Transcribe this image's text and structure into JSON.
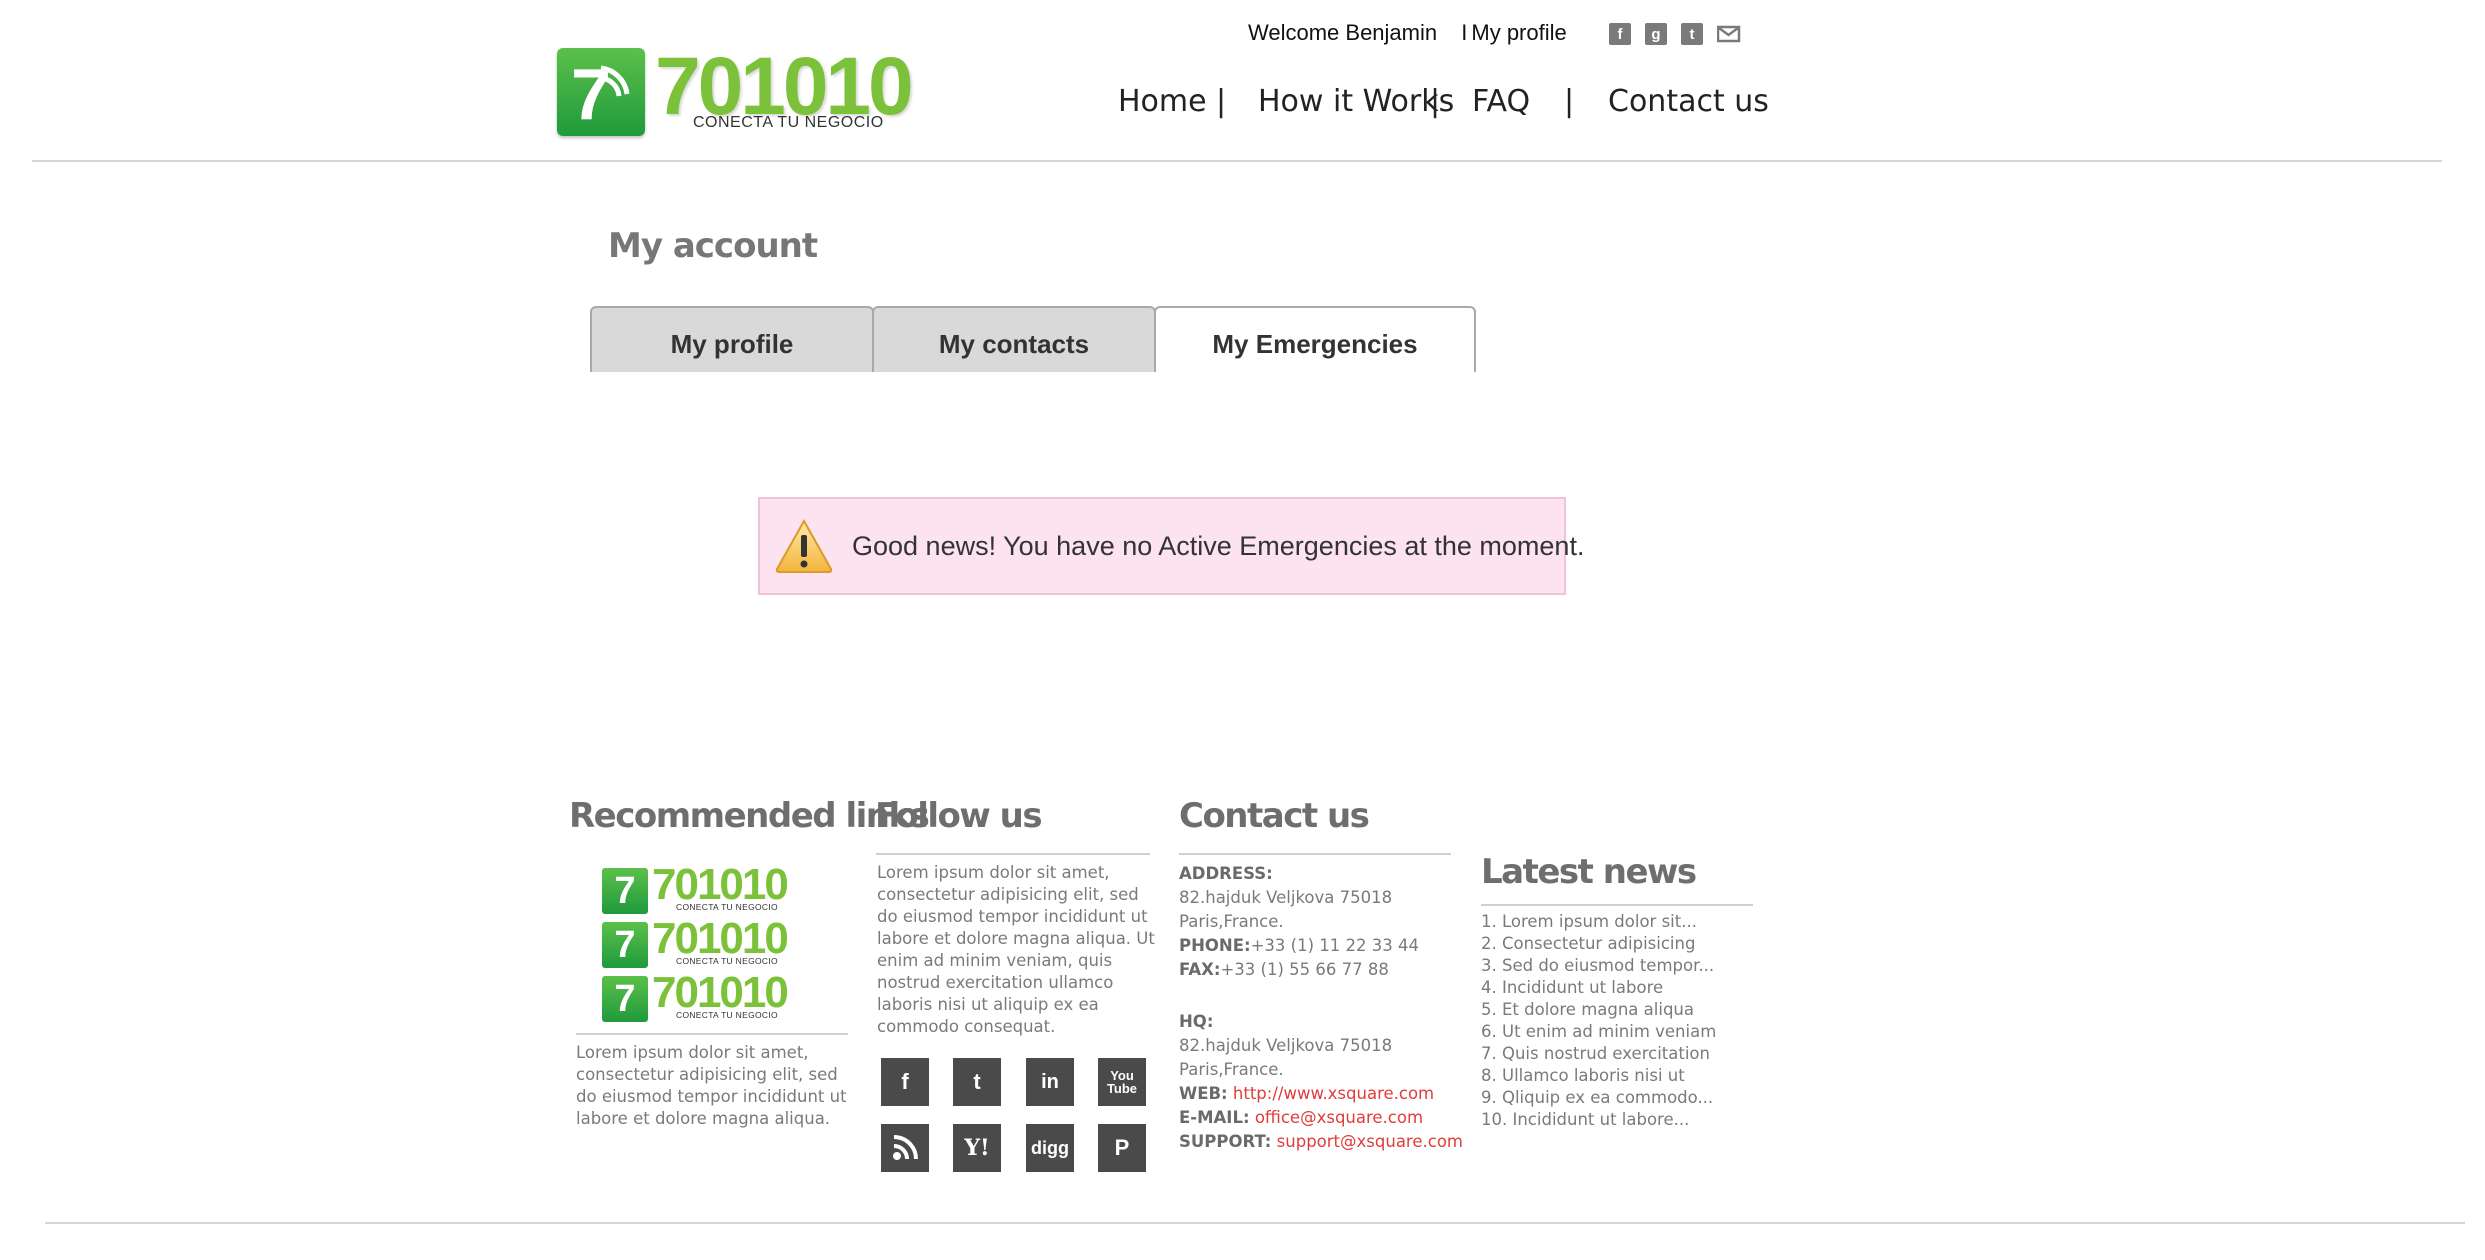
{
  "brand": {
    "logo_number": "701010",
    "logo_tagline": "CONECTA TU NEGOCIO",
    "logo_digit": "7",
    "primary_green": "#7cc13a",
    "dark_green": "#1f9a3c"
  },
  "topbar": {
    "welcome": "Welcome Benjamin",
    "separator": "I",
    "profile_link": "My profile",
    "social_icons": [
      "facebook-icon",
      "google-plus-icon",
      "twitter-icon",
      "mail-icon"
    ]
  },
  "nav": {
    "items": [
      "Home",
      "How it Works",
      "FAQ",
      "Contact us"
    ],
    "separator": "|"
  },
  "account": {
    "title": "My account",
    "tabs": [
      {
        "label": "My profile",
        "active": false
      },
      {
        "label": "My contacts",
        "active": false
      },
      {
        "label": "My Emergencies",
        "active": true
      }
    ]
  },
  "alert": {
    "icon": "warning-icon",
    "message": "Good news! You have no Active Emergencies at the moment.",
    "background": "#fde3ef"
  },
  "footer": {
    "recommended": {
      "title": "Recommended links",
      "text": "Lorem ipsum dolor sit amet, consectetur adipisicing elit, sed do eiusmod tempor incididunt ut labore et dolore magna aliqua."
    },
    "follow": {
      "title": "Follow us",
      "text": "Lorem ipsum dolor sit amet, consectetur adipisicing elit, sed do eiusmod tempor incididunt ut labore et dolore magna aliqua. Ut enim ad minim veniam, quis nostrud exercitation ullamco laboris nisi ut aliquip ex ea commodo consequat.",
      "icons": [
        "facebook-icon",
        "twitter-icon",
        "linkedin-icon",
        "youtube-icon",
        "rss-icon",
        "yahoo-icon",
        "digg-icon",
        "pinterest-icon"
      ],
      "icon_glyphs": [
        "f",
        "t",
        "in",
        "You Tube",
        "⋱",
        "Y!",
        "digg",
        "P"
      ]
    },
    "contact": {
      "title": "Contact us",
      "address_label": "ADDRESS:",
      "address_line1": "82.hajduk Veljkova 75018",
      "address_line2": "Paris,France.",
      "phone_label": "PHONE:",
      "phone": "+33 (1) 11 22 33 44",
      "fax_label": "FAX:",
      "fax": "+33 (1) 55 66 77 88",
      "hq_label": "HQ:",
      "hq_line1": "82.hajduk Veljkova 75018",
      "hq_line2": "Paris,France.",
      "web_label": "WEB:",
      "web": "http://www.xsquare.com",
      "email_label": "E-MAIL:",
      "email": "office@xsquare.com",
      "support_label": "SUPPORT:",
      "support": "support@xsquare.com"
    },
    "news": {
      "title": "Latest news",
      "items": [
        "1. Lorem ipsum dolor sit...",
        "2. Consectetur adipisicing",
        "3. Sed do eiusmod tempor...",
        "4. Incididunt ut labore",
        "5. Et dolore magna aliqua",
        "6. Ut enim ad minim veniam",
        "7. Quis nostrud exercitation",
        "8. Ullamco laboris nisi ut",
        "9. Qliquip ex ea commodo...",
        "10. Incididunt ut labore..."
      ]
    }
  }
}
